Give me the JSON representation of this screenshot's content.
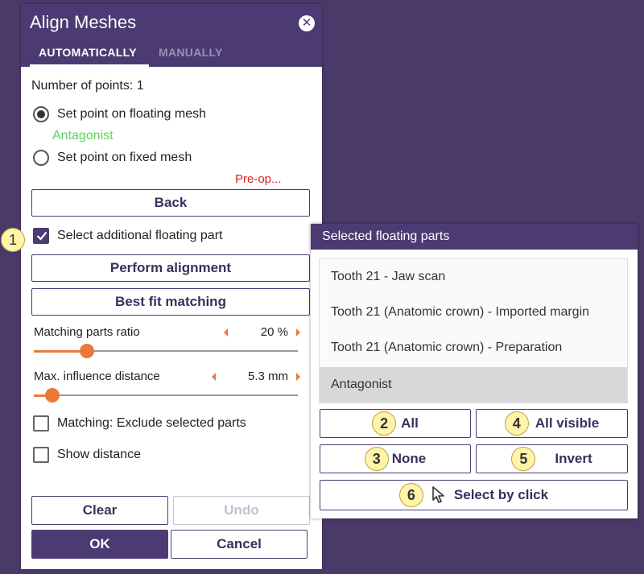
{
  "dialog": {
    "title": "Align Meshes",
    "tabs": [
      {
        "label": "AUTOMATICALLY",
        "active": true
      },
      {
        "label": "MANUALLY",
        "active": false
      }
    ],
    "number_of_points": "Number of points: 1",
    "radio_floating_label": "Set point on floating mesh",
    "floating_mesh_name": "Antagonist",
    "radio_fixed_label": "Set point on fixed mesh",
    "fixed_mesh_name": "Pre-op...",
    "back_label": "Back",
    "select_additional_label": "Select additional floating part",
    "perform_alignment_label": "Perform alignment",
    "best_fit_label": "Best fit matching",
    "matching_ratio": {
      "label": "Matching parts ratio",
      "value": "20 %",
      "fraction": 0.2
    },
    "max_influence": {
      "label": "Max. influence distance",
      "value": "5.3 mm",
      "fraction": 0.07
    },
    "exclude_selected_label": "Matching: Exclude selected parts",
    "show_distance_label": "Show distance",
    "clear_label": "Clear",
    "undo_label": "Undo",
    "ok_label": "OK",
    "cancel_label": "Cancel"
  },
  "panel": {
    "title": "Selected floating parts",
    "items": [
      {
        "label": "Tooth 21 - Jaw scan",
        "selected": false
      },
      {
        "label": "Tooth 21 (Anatomic crown) - Imported margin",
        "selected": false
      },
      {
        "label": "Tooth 21 (Anatomic crown) - Preparation",
        "selected": false
      },
      {
        "label": "Antagonist",
        "selected": true
      }
    ],
    "all_label": "All",
    "all_visible_label": "All visible",
    "none_label": "None",
    "invert_label": "Invert",
    "select_by_click_label": "Select by click"
  },
  "callouts": [
    "1",
    "2",
    "3",
    "4",
    "5",
    "6"
  ],
  "colors": {
    "accent": "#4b3b72",
    "slider": "#ea7a3a",
    "floating_mesh": "#5fd05f",
    "fixed_mesh": "#e02020",
    "background": "#4a3a6a"
  }
}
